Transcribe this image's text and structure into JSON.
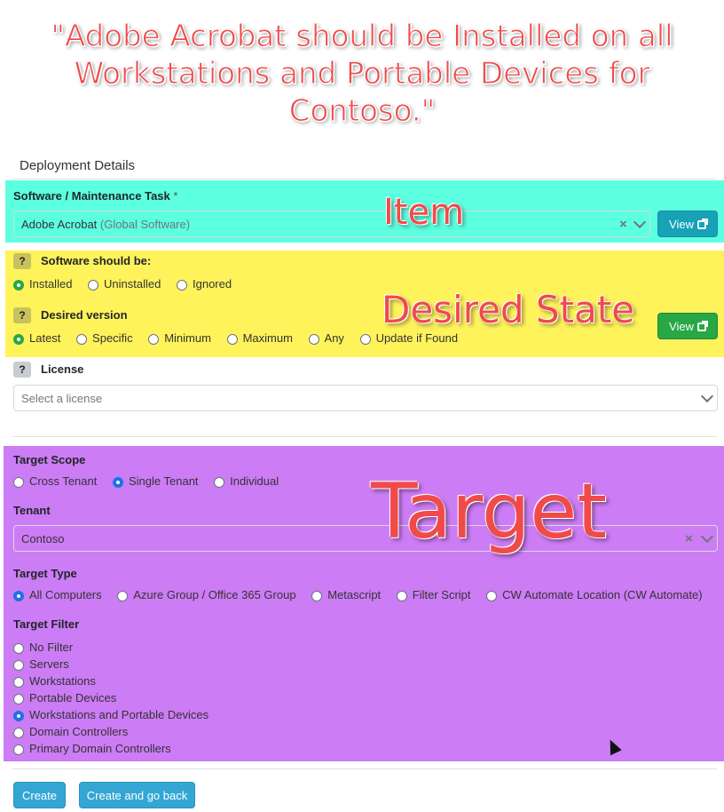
{
  "banner": {
    "lines": [
      "\"Adobe Acrobat should be Installed on all",
      "Workstations and Portable Devices for",
      "Contoso.\""
    ]
  },
  "overlays": {
    "item": "Item",
    "desired_state": "Desired State",
    "target": "Target"
  },
  "colors": {
    "item_band": "#5cffe0",
    "state_band": "#fff35b",
    "target_band": "#cc7cf5",
    "annotation_text": "#f04a4a"
  },
  "deployment": {
    "title": "Deployment Details",
    "software": {
      "label": "Software / Maintenance Task",
      "required_mark": "*",
      "value": "Adobe Acrobat",
      "value_suffix": "(Global Software)",
      "view_label": "View"
    },
    "should_be": {
      "help": "?",
      "label": "Software should be:",
      "options": [
        "Installed",
        "Uninstalled",
        "Ignored"
      ],
      "selected": "Installed"
    },
    "desired_version": {
      "help": "?",
      "label": "Desired version",
      "options": [
        "Latest",
        "Specific",
        "Minimum",
        "Maximum",
        "Any",
        "Update if Found"
      ],
      "selected": "Latest",
      "view_label": "View"
    },
    "license": {
      "help": "?",
      "label": "License",
      "placeholder": "Select a license"
    }
  },
  "target": {
    "scope": {
      "label": "Target Scope",
      "options": [
        "Cross Tenant",
        "Single Tenant",
        "Individual"
      ],
      "selected": "Single Tenant"
    },
    "tenant": {
      "label": "Tenant",
      "value": "Contoso"
    },
    "type": {
      "label": "Target Type",
      "options": [
        "All Computers",
        "Azure Group / Office 365 Group",
        "Metascript",
        "Filter Script",
        "CW Automate Location (CW Automate)"
      ],
      "selected": "All Computers"
    },
    "filter": {
      "label": "Target Filter",
      "options": [
        "No Filter",
        "Servers",
        "Workstations",
        "Portable Devices",
        "Workstations and Portable Devices",
        "Domain Controllers",
        "Primary Domain Controllers"
      ],
      "selected": "Workstations and Portable Devices"
    }
  },
  "footer": {
    "create_label": "Create",
    "create_back_label": "Create and go back"
  }
}
